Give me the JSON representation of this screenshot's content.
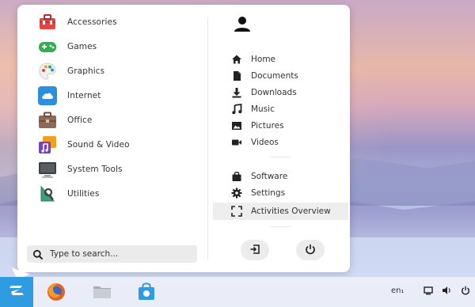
{
  "menu": {
    "categories": [
      {
        "label": "Accessories",
        "icon": "toolbox-icon",
        "color": "#e64343"
      },
      {
        "label": "Games",
        "icon": "gamepad-icon",
        "color": "#2fb050"
      },
      {
        "label": "Graphics",
        "icon": "palette-icon",
        "color": "#f2f2f2"
      },
      {
        "label": "Internet",
        "icon": "cloud-icon",
        "color": "#2b8fe0"
      },
      {
        "label": "Office",
        "icon": "briefcase-icon",
        "color": "#8b6a57"
      },
      {
        "label": "Sound & Video",
        "icon": "media-icon",
        "color": "#f0a020"
      },
      {
        "label": "System Tools",
        "icon": "monitor-icon",
        "color": "#3d3f44"
      },
      {
        "label": "Utilities",
        "icon": "utilities-icon",
        "color": "#3aa07a"
      }
    ],
    "search": {
      "placeholder": "Type to search..."
    },
    "places": [
      {
        "label": "Home",
        "icon": "home-icon"
      },
      {
        "label": "Documents",
        "icon": "document-icon"
      },
      {
        "label": "Downloads",
        "icon": "download-icon"
      },
      {
        "label": "Music",
        "icon": "music-icon"
      },
      {
        "label": "Pictures",
        "icon": "image-icon"
      },
      {
        "label": "Videos",
        "icon": "video-icon"
      }
    ],
    "system": [
      {
        "label": "Software",
        "icon": "shopping-bag-icon"
      },
      {
        "label": "Settings",
        "icon": "gear-icon"
      },
      {
        "label": "Activities Overview",
        "icon": "expand-icon"
      }
    ]
  },
  "taskbar": {
    "keyboard_layout": "en₁"
  },
  "colors": {
    "accent": "#2f9be0",
    "highlight": "#eeeeee"
  }
}
